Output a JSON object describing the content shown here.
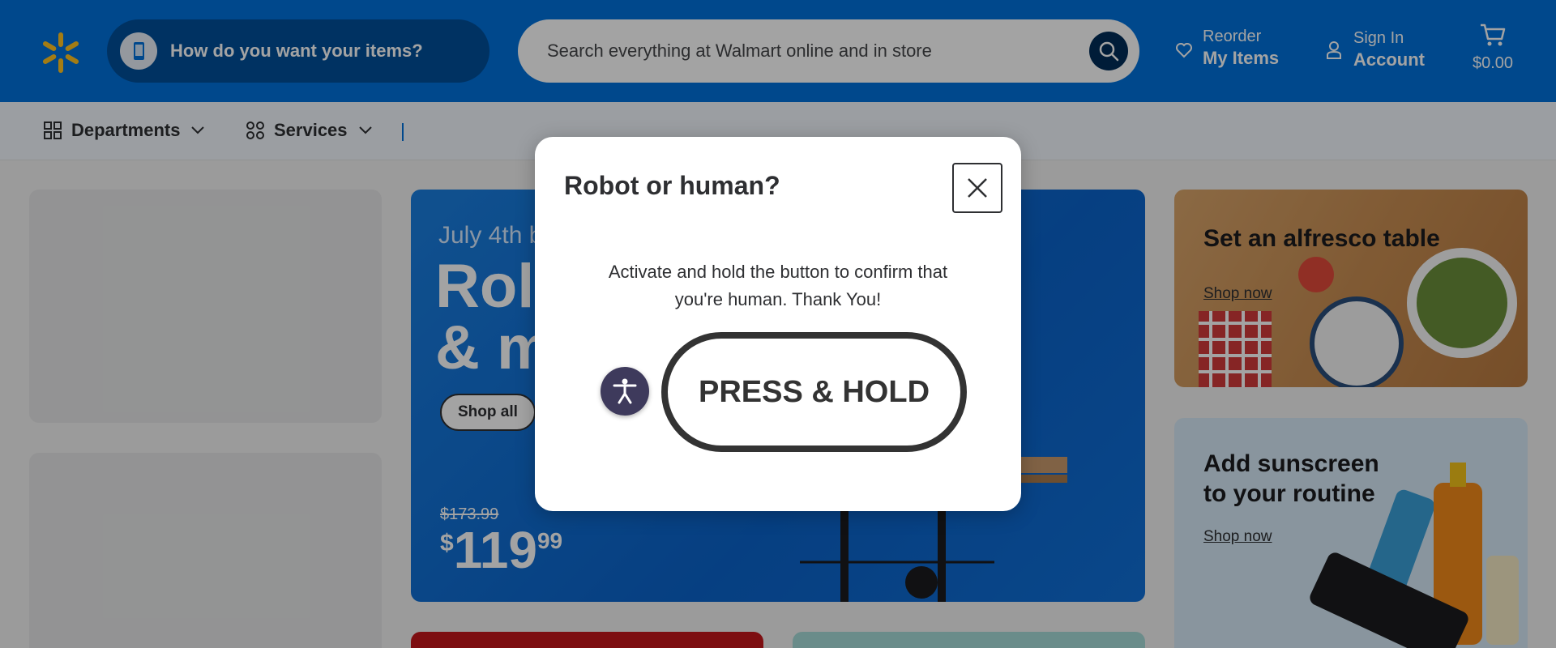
{
  "header": {
    "delivery_label": "How do you want your items?",
    "search_placeholder": "Search everything at Walmart online and in store",
    "reorder_small": "Reorder",
    "reorder_big": "My Items",
    "signin_small": "Sign In",
    "signin_big": "Account",
    "cart_amount": "$0.00",
    "brand_blue": "#0071dc",
    "spark_yellow": "#ffc220"
  },
  "subnav": {
    "departments": "Departments",
    "services": "Services"
  },
  "hero": {
    "tag": "July 4th b",
    "title_line1": "Roll",
    "title_line2": "& m",
    "shop_label": "Shop all",
    "was_price": "$173.99",
    "price_currency": "$",
    "price_dollars": "119",
    "price_cents": "99"
  },
  "side_cards": [
    {
      "title": "Set an alfresco table",
      "link": "Shop now"
    },
    {
      "title_line1": "Add sunscreen",
      "title_line2": "to your routine",
      "link": "Shop now"
    }
  ],
  "modal": {
    "title": "Robot or human?",
    "message": "Activate and hold the button to confirm that you're human. Thank You!",
    "hold_label": "PRESS & HOLD"
  }
}
